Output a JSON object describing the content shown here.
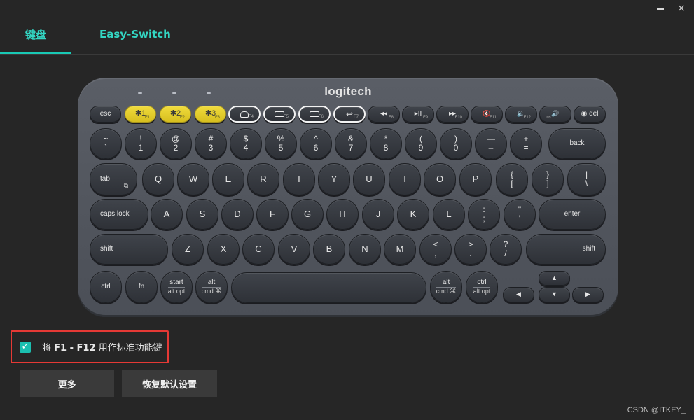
{
  "window": {
    "minimize_label": "",
    "close_label": "×"
  },
  "tabs": [
    {
      "label": "键盘",
      "active": true
    },
    {
      "label": "Easy-Switch",
      "active": false
    }
  ],
  "keyboard": {
    "brand": "logitech",
    "frow": {
      "esc": "esc",
      "bt1": "✱1",
      "bt1_sub": "F1",
      "bt2": "✱2",
      "bt2_sub": "F2",
      "bt3": "✱3",
      "bt3_sub": "F3",
      "f4_sub": "F4",
      "f5_sub": "F5",
      "f6_sub": "F6",
      "f7": "↩",
      "f7_sub": "F7",
      "f8": "◂◂",
      "f8_sub": "F8",
      "f9": "▸II",
      "f9_sub": "F9",
      "f10": "▸▸",
      "f10_sub": "F10",
      "f11": "🔇",
      "f11_sub": "F11",
      "f12": "🔉",
      "f12_sub": "F12",
      "ins": "🔊",
      "ins_sub": "ins",
      "del": "◉ del"
    },
    "row1": [
      {
        "up": "~",
        "down": "`"
      },
      {
        "up": "!",
        "down": "1"
      },
      {
        "up": "@",
        "down": "2"
      },
      {
        "up": "#",
        "down": "3"
      },
      {
        "up": "$",
        "down": "4"
      },
      {
        "up": "%",
        "down": "5"
      },
      {
        "up": "^",
        "down": "6"
      },
      {
        "up": "&",
        "down": "7"
      },
      {
        "up": "*",
        "down": "8"
      },
      {
        "up": "(",
        "down": "9"
      },
      {
        "up": ")",
        "down": "0"
      },
      {
        "up": "—",
        "down": "–"
      },
      {
        "up": "+",
        "down": "="
      }
    ],
    "back": "back",
    "tab": "tab",
    "row2": [
      "Q",
      "W",
      "E",
      "R",
      "T",
      "Y",
      "U",
      "I",
      "O",
      "P"
    ],
    "row2_sym": [
      {
        "up": "{",
        "down": "["
      },
      {
        "up": "}",
        "down": "]"
      },
      {
        "up": "|",
        "down": "\\"
      }
    ],
    "caps": "caps lock",
    "row3": [
      "A",
      "S",
      "D",
      "F",
      "G",
      "H",
      "J",
      "K",
      "L"
    ],
    "row3_sym": [
      {
        "up": ":",
        "down": ";"
      },
      {
        "up": "\"",
        "down": "'"
      }
    ],
    "enter": "enter",
    "shift_left": "shift",
    "row4": [
      "Z",
      "X",
      "C",
      "V",
      "B",
      "N",
      "M"
    ],
    "row4_sym": [
      {
        "up": "<",
        "down": ","
      },
      {
        "up": ">",
        "down": "."
      },
      {
        "up": "?",
        "down": "/"
      }
    ],
    "shift_right": "shift",
    "ctrl_left": "ctrl",
    "fn": "fn",
    "start": "start",
    "start_sub": "alt opt",
    "alt_left": "alt",
    "alt_left_sub": "cmd ⌘",
    "alt_right": "alt",
    "alt_right_sub": "cmd ⌘",
    "ctrl_right": "ctrl",
    "ctrl_right_sub": "alt opt",
    "arrow_up": "▲",
    "arrow_left": "◀",
    "arrow_down": "▼",
    "arrow_right": "▶"
  },
  "fkeys_option": {
    "checked": true,
    "check_glyph": "✓",
    "prefix": "将",
    "keys": "F1 - F12",
    "suffix": "用作标准功能键"
  },
  "buttons": {
    "more": "更多",
    "reset": "恢复默认设置"
  },
  "watermark": "CSDN @ITKEY_",
  "colors": {
    "accent": "#19c9b5",
    "highlight_border": "#e53935",
    "bt_keys": "#e6cf2c"
  }
}
